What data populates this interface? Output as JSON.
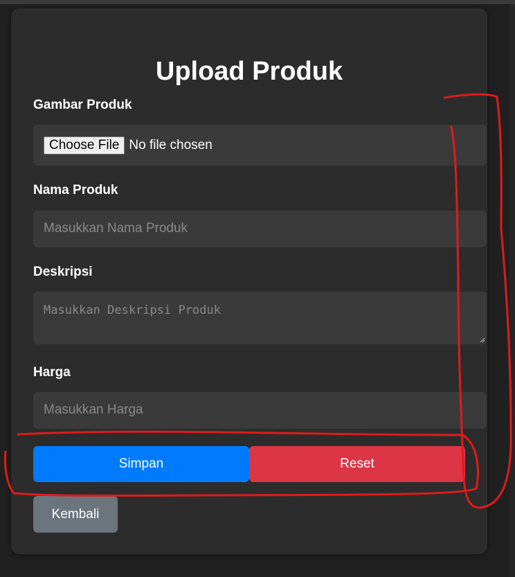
{
  "form": {
    "title": "Upload Produk",
    "image_label": "Gambar Produk",
    "file_button": "Choose File",
    "file_status": "No file chosen",
    "name_label": "Nama Produk",
    "name_placeholder": "Masukkan Nama Produk",
    "desc_label": "Deskripsi",
    "desc_placeholder": "Masukkan Deskripsi Produk",
    "price_label": "Harga",
    "price_placeholder": "Masukkan Harga"
  },
  "buttons": {
    "save": "Simpan",
    "reset": "Reset",
    "back": "Kembali"
  },
  "colors": {
    "save": "#007bff",
    "reset": "#dc3545",
    "back": "#6c757d",
    "annotation": "#e01b1b"
  }
}
